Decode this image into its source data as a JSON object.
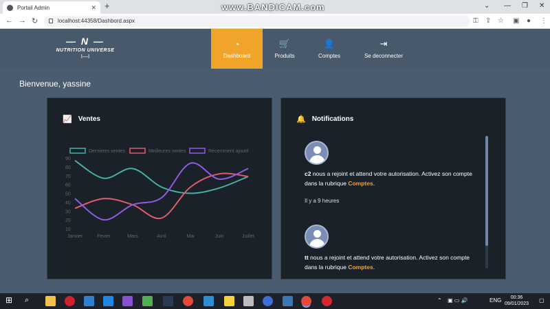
{
  "browser": {
    "tab_title": "Portail Admin",
    "new_tab": "+",
    "url": "localhost:44358/Dashbord.aspx",
    "watermark": "www.BANDICAM.com"
  },
  "app": {
    "brand_mark": "— N —",
    "brand_name": "NUTRITION UNIVERSE",
    "brand_bar": "I—I",
    "nav": [
      {
        "label": "Dashboard",
        "icon": "dashboard-gauge-icon",
        "active": true
      },
      {
        "label": "Produits",
        "icon": "cart-icon",
        "active": false
      },
      {
        "label": "Comptes",
        "icon": "user-icon",
        "active": false
      },
      {
        "label": "Se deconnecter",
        "icon": "sign-out-icon",
        "active": false
      }
    ],
    "welcome": "Bienvenue, yassine"
  },
  "sales_card": {
    "title": "Ventes",
    "icon": "line-chart-icon"
  },
  "chart_data": {
    "type": "line",
    "categories": [
      "Janvier",
      "Fevier",
      "Mars",
      "Avril",
      "Mai",
      "Juin",
      "Juillet"
    ],
    "ylim": [
      10,
      90
    ],
    "yticks": [
      10,
      20,
      30,
      40,
      50,
      60,
      70,
      80,
      90
    ],
    "legend_position": "top",
    "series": [
      {
        "name": "Dernieres ventes",
        "color": "#45b0a5",
        "values": [
          87,
          67,
          78,
          57,
          50,
          56,
          69
        ]
      },
      {
        "name": "Meilleures ventes",
        "color": "#e25b6e",
        "values": [
          33,
          44,
          37,
          22,
          57,
          72,
          69
        ]
      },
      {
        "name": "Récemment ajouté",
        "color": "#8f5be3",
        "values": [
          44,
          20,
          37,
          45,
          84,
          66,
          78
        ]
      }
    ]
  },
  "notif_card": {
    "title": "Notifications",
    "icon": "bell-icon",
    "items": [
      {
        "user": "c2",
        "message": " nous a rejoint et attend votre autorisation. Activez son compte dans la rubrique ",
        "link": "Comptes",
        "end": ".",
        "time": "Il y a 9 heures"
      },
      {
        "user": "tt",
        "message": " nous a rejoint et attend votre autorisation. Activez son compte dans la rubrique ",
        "link": "Comptes",
        "end": ".",
        "time": ""
      }
    ]
  },
  "taskbar": {
    "lang": "ENG",
    "time": "00:36",
    "date": "09/01/2023"
  }
}
